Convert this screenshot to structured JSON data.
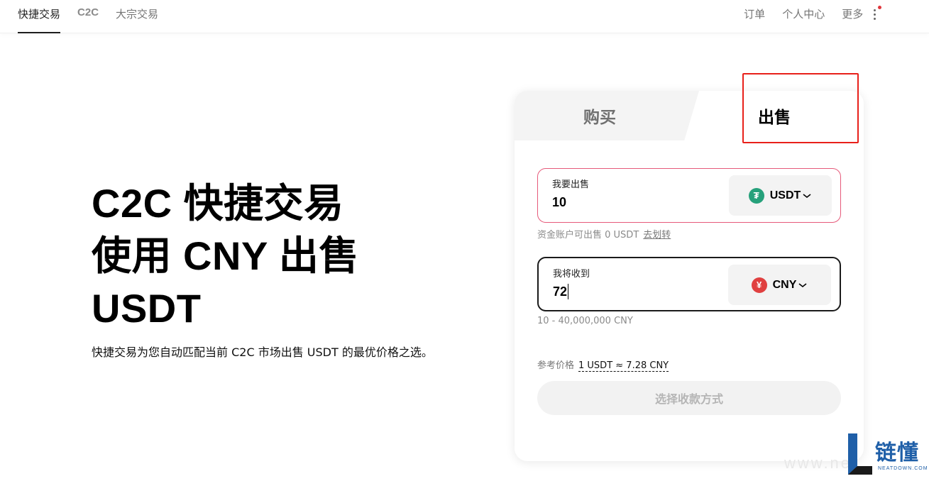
{
  "nav": {
    "left": [
      {
        "label": "快捷交易",
        "active": true
      },
      {
        "label": "C2C",
        "active": false
      },
      {
        "label": "大宗交易",
        "active": false
      }
    ],
    "right": {
      "orders": "订单",
      "account": "个人中心",
      "more": "更多"
    }
  },
  "hero": {
    "line1": "C2C 快捷交易",
    "line2": "使用 CNY 出售",
    "line3": "USDT",
    "description": "快捷交易为您自动匹配当前 C2C 市场出售 USDT 的最优价格之选。"
  },
  "card": {
    "tabs": {
      "buy": "购买",
      "sell": "出售",
      "active": "sell"
    },
    "sell_field": {
      "label": "我要出售",
      "value": "10",
      "currency": "USDT"
    },
    "available": {
      "text": "资金账户可出售 0 USDT",
      "link": "去划转"
    },
    "receive_field": {
      "label": "我将收到",
      "value": "72",
      "currency": "CNY"
    },
    "range": "10 - 40,000,000 CNY",
    "reference": {
      "label": "参考价格",
      "value": "1 USDT ≈ 7.28 CNY"
    },
    "submit_label": "选择收款方式"
  },
  "watermark": {
    "text": "链懂",
    "sub": "NEATDOWN.COM",
    "url": "www.ne"
  },
  "colors": {
    "accent_error": "#e65a7a",
    "highlight": "#e8201a",
    "usdt": "#26a17b",
    "cny": "#e04040",
    "brand_blue": "#1f5fa8"
  }
}
